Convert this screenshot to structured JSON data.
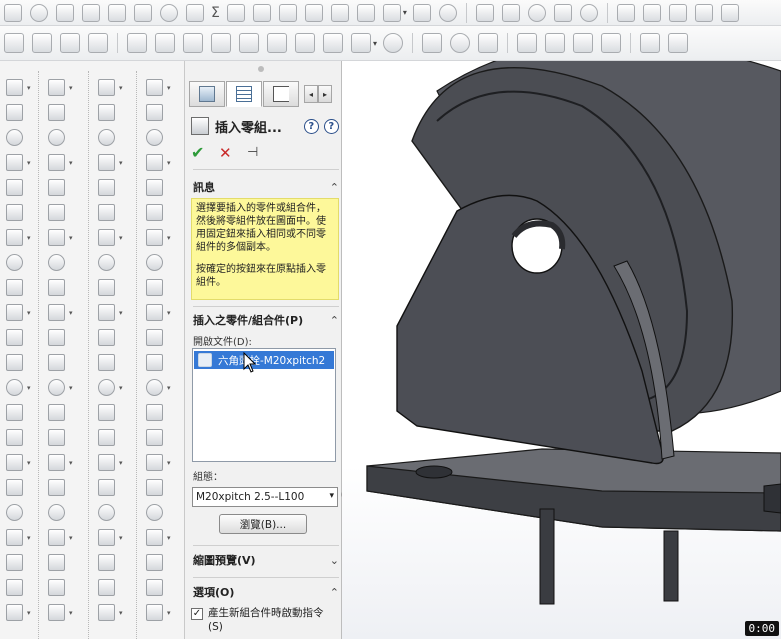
{
  "panel": {
    "title": "插入零組...",
    "tabs": [
      "property-manager-tab",
      "feature-tree-tab",
      "configuration-tab"
    ],
    "sections": {
      "message": {
        "title": "訊息",
        "paragraph1": "選擇要插入的零件或組合件，然後將零組件放在圖面中。使用固定鈕來插入相同或不同零組件的多個副本。",
        "paragraph2": "按確定的按鈕來在原點插入零組件。"
      },
      "insert": {
        "title": "插入之零件/組合件(P)",
        "open_docs_label": "開啟文件(D):",
        "open_docs": [
          "六角頭栓-M20xpitch2"
        ],
        "config_label": "組態：",
        "config_value": "M20xpitch 2.5--L100",
        "browse_label": "瀏覽(B)..."
      },
      "thumbnail": {
        "title": "縮圖預覽(V)"
      },
      "options": {
        "title": "選項(O)",
        "checkbox_label": "產生新組合件時啟動指令(S)",
        "checkbox_checked": true,
        "check_mark": "✓"
      }
    },
    "actions": {
      "ok_glyph": "✔",
      "cancel_glyph": "✕",
      "pin_glyph": "⊣"
    },
    "help_glyphs": [
      "?",
      "?"
    ],
    "chevron_up": "⌃",
    "chevron_down": "⌄",
    "tab_scroll_left": "◂",
    "tab_scroll_right": "▸"
  },
  "timer": "0:00",
  "colors": {
    "message_bg": "#fdf89a",
    "selection_bg": "#3579d6",
    "model_face": "#55575d",
    "model_edge": "#1a1a1a",
    "ok_green": "#2e9b3a",
    "cancel_red": "#c92a2a"
  },
  "toolbar_glyphs": {
    "sum": "Σ",
    "drop": "▾"
  }
}
